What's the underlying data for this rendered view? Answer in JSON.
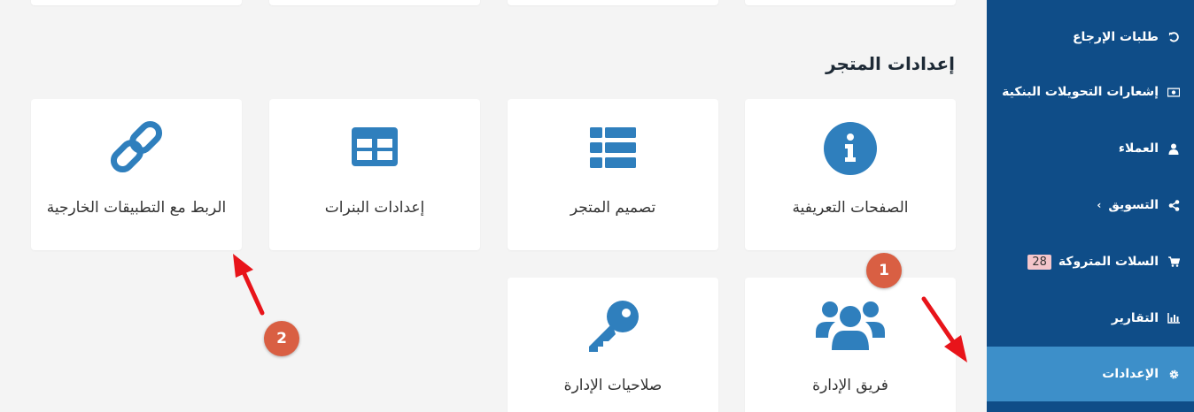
{
  "sidebar": {
    "items": [
      {
        "label": "طلبات الإرجاع",
        "icon": "undo-icon"
      },
      {
        "label": "إشعارات التحويلات البنكية",
        "icon": "money-icon"
      },
      {
        "label": "العملاء",
        "icon": "user-icon"
      },
      {
        "label": "التسويق",
        "icon": "share-icon"
      },
      {
        "label": "السلات المتروكة",
        "icon": "cart-icon",
        "badge": "28"
      },
      {
        "label": "التقارير",
        "icon": "bar-chart-icon"
      },
      {
        "label": "الإعدادات",
        "icon": "gear-icon",
        "active": true
      }
    ],
    "colors": {
      "bg": "#0f4d88",
      "active": "#3d8fc9"
    }
  },
  "main": {
    "section_title": "إعدادات المتجر",
    "cards": [
      {
        "label": "الصفحات التعريفية",
        "icon": "info-icon"
      },
      {
        "label": "تصميم المتجر",
        "icon": "list-icon"
      },
      {
        "label": "إعدادات البنرات",
        "icon": "table-icon"
      },
      {
        "label": "الربط مع التطبيقات الخارجية",
        "icon": "link-icon"
      },
      {
        "label": "فريق الإدارة",
        "icon": "users-icon"
      },
      {
        "label": "صلاحيات الإدارة",
        "icon": "key-icon"
      }
    ],
    "icon_color": "#2f7fbd"
  },
  "annotations": {
    "markers": [
      "1",
      "2"
    ],
    "color": "#d95f43",
    "arrow_color": "#e8141a"
  }
}
